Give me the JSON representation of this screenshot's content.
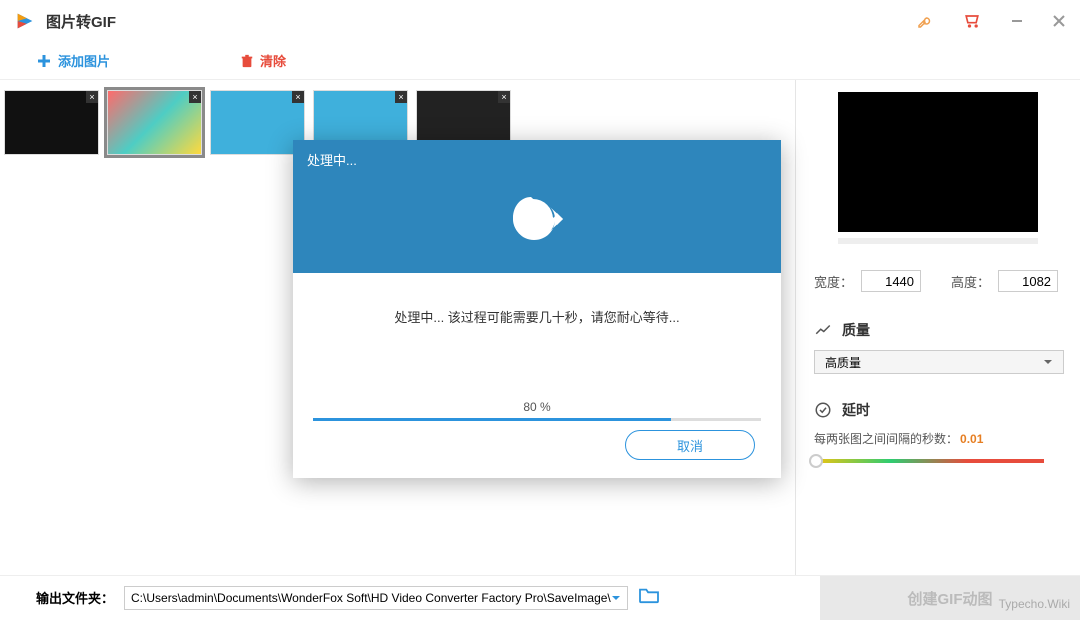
{
  "titlebar": {
    "title": "图片转GIF"
  },
  "toolbar": {
    "add_label": "添加图片",
    "clear_label": "清除"
  },
  "right": {
    "width_label": "宽度：",
    "width_value": "1440",
    "height_label": "高度：",
    "height_value": "1082",
    "quality_title": "质量",
    "quality_selected": "高质量",
    "delay_title": "延时",
    "delay_label": "每两张图之间间隔的秒数：",
    "delay_value": "0.01"
  },
  "footer": {
    "output_label": "输出文件夹：",
    "path": "C:\\Users\\admin\\Documents\\WonderFox Soft\\HD Video Converter Factory Pro\\SaveImage\\",
    "create_label": "创建GIF动图"
  },
  "modal": {
    "title": "处理中...",
    "message": "处理中... 该过程可能需要几十秒，请您耐心等待...",
    "progress_label": "80 %",
    "progress_percent": 80,
    "cancel_label": "取消"
  },
  "watermark": "Typecho.Wiki"
}
